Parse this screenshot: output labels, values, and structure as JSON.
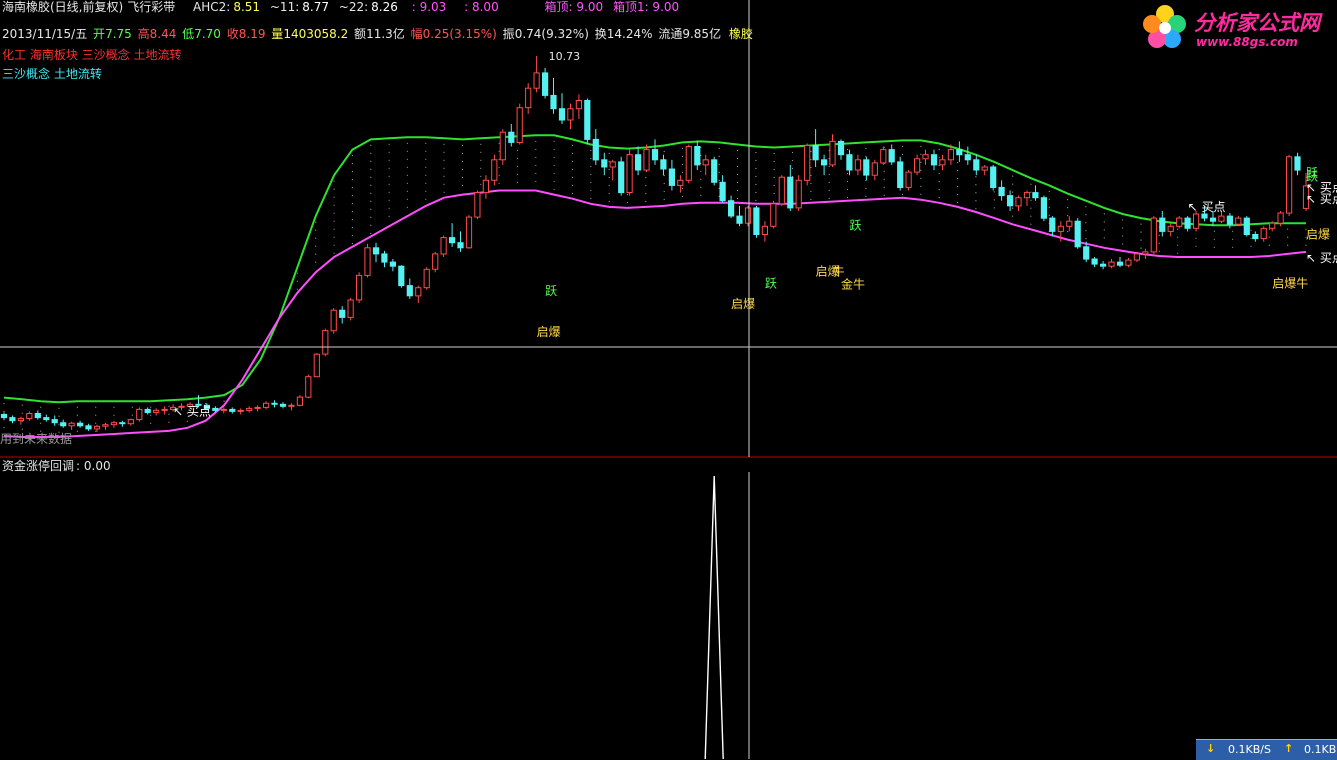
{
  "header": {
    "title": "海南橡胶(日线,前复权)",
    "formula": "飞行彩带",
    "ahc2_label": "AHC2:",
    "ahc2": "8.51",
    "l11_label": "~11:",
    "l11": "8.77",
    "l22_label": "~22:",
    "l22": "8.26",
    "v1": ": 9.03",
    "v2": ": 8.00",
    "box_top_label": "箱顶: 9.00",
    "box_top1_label": "箱顶1: 9.00"
  },
  "quote": {
    "date": "2013/11/15/五",
    "open_label": "开",
    "open": "7.75",
    "high_label": "高",
    "high": "8.44",
    "low_label": "低",
    "low": "7.70",
    "close_label": "收",
    "close": "8.19",
    "volume_label": "量",
    "volume": "1403058.2",
    "amount_label": "额",
    "amount": "11.3亿",
    "change_label": "幅",
    "change": "0.25(3.15%)",
    "amplitude_label": "振",
    "amplitude": "0.74(9.32%)",
    "turnover_label": "换",
    "turnover": "14.24%",
    "float_label": "流通",
    "float": "9.85亿",
    "industry": "橡胶"
  },
  "concepts_red": "化工 海南板块 三沙概念 土地流转",
  "concepts_cyan": "三沙概念 土地流转",
  "warning": "用到未来数据",
  "sub_panel": {
    "label": "资金涨停回调",
    "value": ": 0.00"
  },
  "logo": {
    "name": "分析家公式网",
    "url": "www.88gs.com"
  },
  "netbar": {
    "down": "0.1KB/S",
    "up": "0.1KB"
  },
  "colors": {
    "up": "#ff4b4b",
    "down": "#55f0f0",
    "upper_band": "#2fe22f",
    "lower_band": "#ff4dff",
    "crosshair": "#cfcfcf",
    "divider": "#d00000"
  },
  "chart_data": [
    {
      "type": "candlestick",
      "name": "main",
      "ohlc": [
        [
          3.72,
          3.76,
          3.62,
          3.66
        ],
        [
          3.66,
          3.7,
          3.55,
          3.6
        ],
        [
          3.6,
          3.68,
          3.52,
          3.64
        ],
        [
          3.64,
          3.78,
          3.6,
          3.74
        ],
        [
          3.74,
          3.8,
          3.62,
          3.66
        ],
        [
          3.66,
          3.72,
          3.58,
          3.62
        ],
        [
          3.62,
          3.7,
          3.5,
          3.56
        ],
        [
          3.56,
          3.62,
          3.46,
          3.5
        ],
        [
          3.5,
          3.58,
          3.42,
          3.55
        ],
        [
          3.55,
          3.6,
          3.46,
          3.5
        ],
        [
          3.5,
          3.54,
          3.4,
          3.44
        ],
        [
          3.44,
          3.52,
          3.38,
          3.49
        ],
        [
          3.49,
          3.56,
          3.42,
          3.52
        ],
        [
          3.52,
          3.6,
          3.46,
          3.56
        ],
        [
          3.56,
          3.6,
          3.48,
          3.54
        ],
        [
          3.54,
          3.64,
          3.5,
          3.62
        ],
        [
          3.62,
          3.86,
          3.58,
          3.82
        ],
        [
          3.82,
          3.86,
          3.72,
          3.76
        ],
        [
          3.76,
          3.84,
          3.7,
          3.8
        ],
        [
          3.8,
          3.88,
          3.72,
          3.82
        ],
        [
          3.82,
          3.92,
          3.78,
          3.86
        ],
        [
          3.86,
          3.94,
          3.8,
          3.88
        ],
        [
          3.88,
          3.96,
          3.84,
          3.92
        ],
        [
          3.92,
          4.1,
          3.86,
          3.9
        ],
        [
          3.9,
          3.94,
          3.8,
          3.84
        ],
        [
          3.84,
          3.88,
          3.76,
          3.8
        ],
        [
          3.8,
          3.86,
          3.74,
          3.82
        ],
        [
          3.82,
          3.86,
          3.74,
          3.78
        ],
        [
          3.78,
          3.84,
          3.72,
          3.8
        ],
        [
          3.8,
          3.88,
          3.76,
          3.84
        ],
        [
          3.84,
          3.9,
          3.78,
          3.86
        ],
        [
          3.86,
          3.98,
          3.82,
          3.94
        ],
        [
          3.94,
          4.0,
          3.86,
          3.92
        ],
        [
          3.92,
          3.96,
          3.84,
          3.88
        ],
        [
          3.88,
          3.94,
          3.8,
          3.9
        ],
        [
          3.9,
          4.1,
          3.88,
          4.06
        ],
        [
          4.06,
          4.5,
          4.04,
          4.46
        ],
        [
          4.46,
          4.92,
          4.46,
          4.9
        ],
        [
          4.9,
          5.4,
          4.86,
          5.36
        ],
        [
          5.36,
          5.8,
          5.3,
          5.76
        ],
        [
          5.76,
          5.84,
          5.5,
          5.62
        ],
        [
          5.62,
          6.0,
          5.56,
          5.96
        ],
        [
          5.96,
          6.5,
          5.9,
          6.44
        ],
        [
          6.44,
          7.06,
          6.4,
          6.98
        ],
        [
          6.98,
          7.08,
          6.7,
          6.86
        ],
        [
          6.86,
          6.92,
          6.6,
          6.7
        ],
        [
          6.7,
          6.76,
          6.52,
          6.62
        ],
        [
          6.62,
          6.64,
          6.2,
          6.24
        ],
        [
          6.24,
          6.38,
          5.98,
          6.04
        ],
        [
          6.04,
          6.24,
          5.9,
          6.2
        ],
        [
          6.2,
          6.6,
          6.16,
          6.56
        ],
        [
          6.56,
          6.9,
          6.5,
          6.86
        ],
        [
          6.86,
          7.22,
          6.8,
          7.18
        ],
        [
          7.18,
          7.46,
          7.0,
          7.08
        ],
        [
          7.08,
          7.3,
          6.9,
          6.98
        ],
        [
          6.98,
          7.62,
          6.96,
          7.58
        ],
        [
          7.58,
          8.1,
          7.54,
          8.06
        ],
        [
          8.06,
          8.4,
          7.94,
          8.3
        ],
        [
          8.3,
          8.8,
          8.2,
          8.7
        ],
        [
          8.7,
          9.3,
          8.6,
          9.24
        ],
        [
          9.24,
          9.4,
          8.96,
          9.04
        ],
        [
          9.04,
          9.8,
          9.0,
          9.72
        ],
        [
          9.72,
          10.2,
          9.6,
          10.1
        ],
        [
          10.1,
          10.73,
          10.02,
          10.4
        ],
        [
          10.4,
          10.5,
          9.9,
          9.96
        ],
        [
          9.96,
          10.3,
          9.6,
          9.7
        ],
        [
          9.7,
          10.0,
          9.4,
          9.48
        ],
        [
          9.48,
          9.8,
          9.3,
          9.7
        ],
        [
          9.7,
          9.98,
          9.5,
          9.86
        ],
        [
          9.86,
          9.9,
          9.0,
          9.1
        ],
        [
          9.1,
          9.3,
          8.6,
          8.7
        ],
        [
          8.7,
          8.84,
          8.4,
          8.56
        ],
        [
          8.56,
          8.7,
          8.3,
          8.66
        ],
        [
          8.66,
          8.76,
          8.0,
          8.06
        ],
        [
          8.06,
          8.9,
          8.0,
          8.8
        ],
        [
          8.8,
          8.96,
          8.4,
          8.5
        ],
        [
          8.5,
          9.0,
          8.46,
          8.9
        ],
        [
          8.9,
          9.1,
          8.6,
          8.7
        ],
        [
          8.7,
          8.8,
          8.4,
          8.52
        ],
        [
          8.52,
          8.7,
          8.1,
          8.2
        ],
        [
          8.2,
          8.4,
          8.06,
          8.3
        ],
        [
          8.3,
          9.0,
          8.24,
          8.96
        ],
        [
          8.96,
          9.08,
          8.5,
          8.6
        ],
        [
          8.6,
          8.8,
          8.4,
          8.7
        ],
        [
          8.7,
          8.76,
          8.2,
          8.26
        ],
        [
          8.26,
          8.4,
          7.86,
          7.9
        ],
        [
          7.9,
          8.0,
          7.56,
          7.6
        ],
        [
          7.6,
          7.8,
          7.4,
          7.46
        ],
        [
          7.46,
          7.8,
          7.4,
          7.76
        ],
        [
          7.76,
          7.8,
          7.18,
          7.24
        ],
        [
          7.24,
          7.5,
          7.1,
          7.4
        ],
        [
          7.4,
          7.9,
          7.36,
          7.84
        ],
        [
          7.84,
          8.4,
          7.8,
          8.36
        ],
        [
          8.36,
          8.6,
          7.7,
          7.76
        ],
        [
          7.76,
          8.4,
          7.7,
          8.3
        ],
        [
          8.3,
          9.02,
          8.2,
          8.98
        ],
        [
          8.98,
          9.3,
          8.56,
          8.7
        ],
        [
          8.7,
          8.8,
          8.4,
          8.6
        ],
        [
          8.6,
          9.2,
          8.56,
          9.06
        ],
        [
          9.06,
          9.1,
          8.7,
          8.8
        ],
        [
          8.8,
          8.9,
          8.4,
          8.5
        ],
        [
          8.5,
          8.8,
          8.4,
          8.7
        ],
        [
          8.7,
          8.76,
          8.3,
          8.4
        ],
        [
          8.4,
          8.7,
          8.3,
          8.64
        ],
        [
          8.64,
          8.96,
          8.6,
          8.9
        ],
        [
          8.9,
          9.0,
          8.6,
          8.66
        ],
        [
          8.66,
          8.76,
          8.1,
          8.16
        ],
        [
          8.16,
          8.5,
          8.1,
          8.46
        ],
        [
          8.46,
          8.8,
          8.4,
          8.72
        ],
        [
          8.72,
          8.9,
          8.6,
          8.8
        ],
        [
          8.8,
          8.9,
          8.5,
          8.6
        ],
        [
          8.6,
          8.8,
          8.5,
          8.7
        ],
        [
          8.7,
          9.0,
          8.6,
          8.9
        ],
        [
          8.9,
          9.06,
          8.66,
          8.8
        ],
        [
          8.8,
          8.96,
          8.6,
          8.7
        ],
        [
          8.7,
          8.8,
          8.4,
          8.5
        ],
        [
          8.5,
          8.6,
          8.4,
          8.56
        ],
        [
          8.56,
          8.6,
          8.1,
          8.16
        ],
        [
          8.16,
          8.3,
          7.9,
          8.0
        ],
        [
          8.0,
          8.1,
          7.7,
          7.8
        ],
        [
          7.8,
          8.0,
          7.7,
          7.96
        ],
        [
          7.96,
          8.1,
          7.8,
          8.06
        ],
        [
          8.06,
          8.2,
          7.9,
          7.96
        ],
        [
          7.96,
          8.0,
          7.5,
          7.56
        ],
        [
          7.56,
          7.6,
          7.2,
          7.3
        ],
        [
          7.3,
          7.5,
          7.1,
          7.4
        ],
        [
          7.4,
          7.6,
          7.3,
          7.5
        ],
        [
          7.5,
          7.56,
          6.96,
          7.0
        ],
        [
          7.0,
          7.1,
          6.7,
          6.76
        ],
        [
          6.76,
          6.8,
          6.6,
          6.66
        ],
        [
          6.66,
          6.72,
          6.56,
          6.62
        ],
        [
          6.62,
          6.76,
          6.58,
          6.7
        ],
        [
          6.7,
          6.8,
          6.6,
          6.64
        ],
        [
          6.64,
          6.78,
          6.6,
          6.74
        ],
        [
          6.74,
          6.9,
          6.7,
          6.86
        ],
        [
          6.86,
          6.96,
          6.76,
          6.9
        ],
        [
          6.9,
          7.6,
          6.86,
          7.56
        ],
        [
          7.56,
          7.7,
          7.2,
          7.3
        ],
        [
          7.3,
          7.46,
          7.2,
          7.4
        ],
        [
          7.4,
          7.6,
          7.36,
          7.56
        ],
        [
          7.56,
          7.6,
          7.3,
          7.36
        ],
        [
          7.36,
          7.7,
          7.3,
          7.64
        ],
        [
          7.64,
          7.8,
          7.5,
          7.56
        ],
        [
          7.56,
          7.7,
          7.4,
          7.5
        ],
        [
          7.5,
          7.7,
          7.46,
          7.6
        ],
        [
          7.6,
          7.66,
          7.36,
          7.44
        ],
        [
          7.44,
          7.6,
          7.4,
          7.56
        ],
        [
          7.56,
          7.6,
          7.2,
          7.24
        ],
        [
          7.24,
          7.3,
          7.1,
          7.16
        ],
        [
          7.16,
          7.4,
          7.1,
          7.36
        ],
        [
          7.36,
          7.5,
          7.3,
          7.46
        ],
        [
          7.46,
          7.7,
          7.4,
          7.66
        ],
        [
          7.66,
          8.8,
          7.6,
          8.76
        ],
        [
          8.76,
          8.84,
          8.4,
          8.5
        ],
        [
          7.75,
          8.44,
          7.7,
          8.19
        ]
      ],
      "price_high": 10.73,
      "upper_band": [
        4.05,
        4.02,
        3.98,
        3.96,
        3.98,
        3.98,
        3.98,
        3.98,
        3.98,
        4.0,
        4.02,
        4.05,
        4.1,
        4.3,
        4.8,
        5.6,
        6.6,
        7.6,
        8.4,
        8.9,
        9.1,
        9.12,
        9.14,
        9.14,
        9.12,
        9.1,
        9.12,
        9.14,
        9.16,
        9.18,
        9.18,
        9.1,
        9.0,
        8.94,
        8.92,
        8.94,
        8.98,
        9.04,
        9.06,
        9.04,
        9.0,
        8.96,
        8.94,
        8.96,
        8.98,
        9.0,
        9.02,
        9.04,
        9.06,
        9.08,
        9.08,
        9.02,
        8.92,
        8.8,
        8.66,
        8.5,
        8.34,
        8.2,
        8.04,
        7.9,
        7.76,
        7.64,
        7.56,
        7.5,
        7.46,
        7.44,
        7.42,
        7.42,
        7.44,
        7.46,
        7.46,
        7.46
      ],
      "lower_band": [
        3.3,
        3.28,
        3.28,
        3.28,
        3.3,
        3.32,
        3.34,
        3.36,
        3.38,
        3.4,
        3.46,
        3.6,
        3.9,
        4.4,
        5.0,
        5.6,
        6.1,
        6.5,
        6.8,
        7.0,
        7.2,
        7.4,
        7.6,
        7.8,
        7.96,
        8.02,
        8.06,
        8.1,
        8.1,
        8.1,
        8.02,
        7.94,
        7.84,
        7.78,
        7.76,
        7.78,
        7.8,
        7.84,
        7.86,
        7.86,
        7.86,
        7.84,
        7.84,
        7.84,
        7.86,
        7.88,
        7.9,
        7.92,
        7.94,
        7.96,
        7.92,
        7.86,
        7.78,
        7.68,
        7.56,
        7.44,
        7.34,
        7.24,
        7.14,
        7.06,
        6.98,
        6.92,
        6.86,
        6.82,
        6.8,
        6.8,
        6.8,
        6.8,
        6.8,
        6.82,
        6.86,
        6.9
      ],
      "annotations": [
        {
          "text": "买点",
          "index": 20,
          "price": 3.7
        },
        {
          "text": "启爆",
          "index": 63,
          "price": 5.26
        },
        {
          "text": "跃",
          "index": 64,
          "price": 6.06
        },
        {
          "text": "启爆",
          "index": 86,
          "price": 5.8
        },
        {
          "text": "跃",
          "index": 90,
          "price": 6.2
        },
        {
          "text": "启爆",
          "index": 96,
          "price": 6.44
        },
        {
          "text": "牛",
          "index": 98,
          "price": 6.44
        },
        {
          "text": "跃",
          "index": 100,
          "price": 7.34
        },
        {
          "text": "金牛",
          "index": 99,
          "price": 6.18
        },
        {
          "text": "买点",
          "index": 140,
          "price": 7.7
        },
        {
          "text": "启爆牛",
          "index": 150,
          "price": 6.2
        },
        {
          "text": "跃",
          "index": 159,
          "price": 8.3
        },
        {
          "text": "买点",
          "index": 154,
          "price": 8.08
        },
        {
          "text": "买点",
          "index": 180,
          "price": 7.86
        },
        {
          "text": "跃",
          "index": 184,
          "price": 8.36
        },
        {
          "text": "买点",
          "index": 250,
          "price": 6.7
        },
        {
          "text": "启爆",
          "index": 265,
          "price": 7.16
        }
      ]
    },
    {
      "type": "line",
      "name": "资金涨停回调",
      "values": [
        0.0,
        1.0,
        0.0
      ],
      "peak_index": 84
    }
  ]
}
